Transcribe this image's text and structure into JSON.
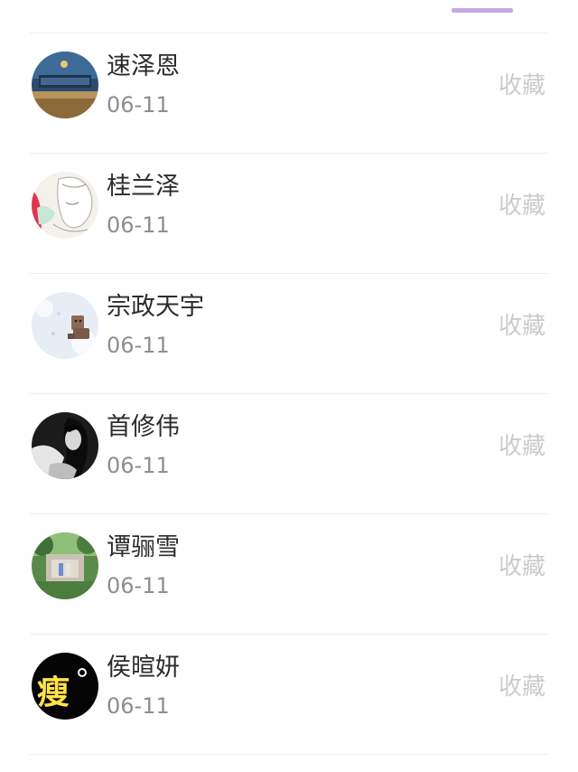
{
  "colors": {
    "tab_indicator": "#c4a7e4",
    "divider": "#efefef",
    "name": "#2b2b2b",
    "date": "#8e8e8e",
    "favorite": "#c9ccc8"
  },
  "list": {
    "items": [
      {
        "name": "速泽恩",
        "date": "06-11",
        "action": "收藏",
        "avatar_icon": "landscape-poster-avatar"
      },
      {
        "name": "桂兰泽",
        "date": "06-11",
        "action": "收藏",
        "avatar_icon": "anime-illustration-avatar"
      },
      {
        "name": "宗政天宇",
        "date": "06-11",
        "action": "收藏",
        "avatar_icon": "winter-toy-avatar"
      },
      {
        "name": "首修伟",
        "date": "06-11",
        "action": "收藏",
        "avatar_icon": "bw-portrait-avatar"
      },
      {
        "name": "谭骊雪",
        "date": "06-11",
        "action": "收藏",
        "avatar_icon": "garden-photo-avatar"
      },
      {
        "name": "侯暄妍",
        "date": "06-11",
        "action": "收藏",
        "avatar_icon": "text-logo-avatar",
        "avatar_text": "瘦"
      }
    ]
  }
}
